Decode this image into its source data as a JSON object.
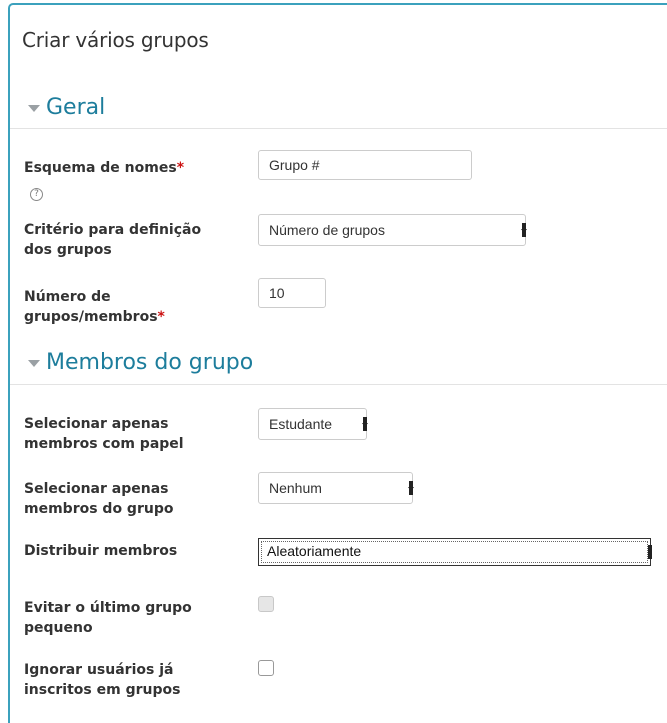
{
  "page": {
    "title": "Criar vários grupos"
  },
  "sections": {
    "geral": {
      "legend": "Geral"
    },
    "membros": {
      "legend": "Membros do grupo"
    }
  },
  "fields": {
    "esquema": {
      "label": "Esquema de nomes",
      "required_mark": "*",
      "value": "Grupo #",
      "help_icon": "question-circle-icon"
    },
    "criterio": {
      "label_line1": "Critério para definição",
      "label_line2": "dos grupos",
      "selected": "Número de grupos"
    },
    "numero": {
      "label_line1": "Número de",
      "label_line2": "grupos/membros",
      "required_mark": "*",
      "value": "10"
    },
    "papel": {
      "label_line1": "Selecionar apenas",
      "label_line2": "membros com papel",
      "selected": "Estudante"
    },
    "grupo": {
      "label_line1": "Selecionar apenas",
      "label_line2": "membros do grupo",
      "selected": "Nenhum"
    },
    "distribuir": {
      "label": "Distribuir membros",
      "selected": "Aleatoriamente"
    },
    "evitar": {
      "label_line1": "Evitar o último grupo",
      "label_line2": "pequeno",
      "checked": false,
      "disabled": true
    },
    "ignorar": {
      "label_line1": "Ignorar usuários já",
      "label_line2": "inscritos em grupos",
      "checked": false,
      "disabled": false
    }
  },
  "colors": {
    "accent": "#1d7d9c",
    "frame": "#3ba1bd",
    "required": "#cc1111"
  }
}
